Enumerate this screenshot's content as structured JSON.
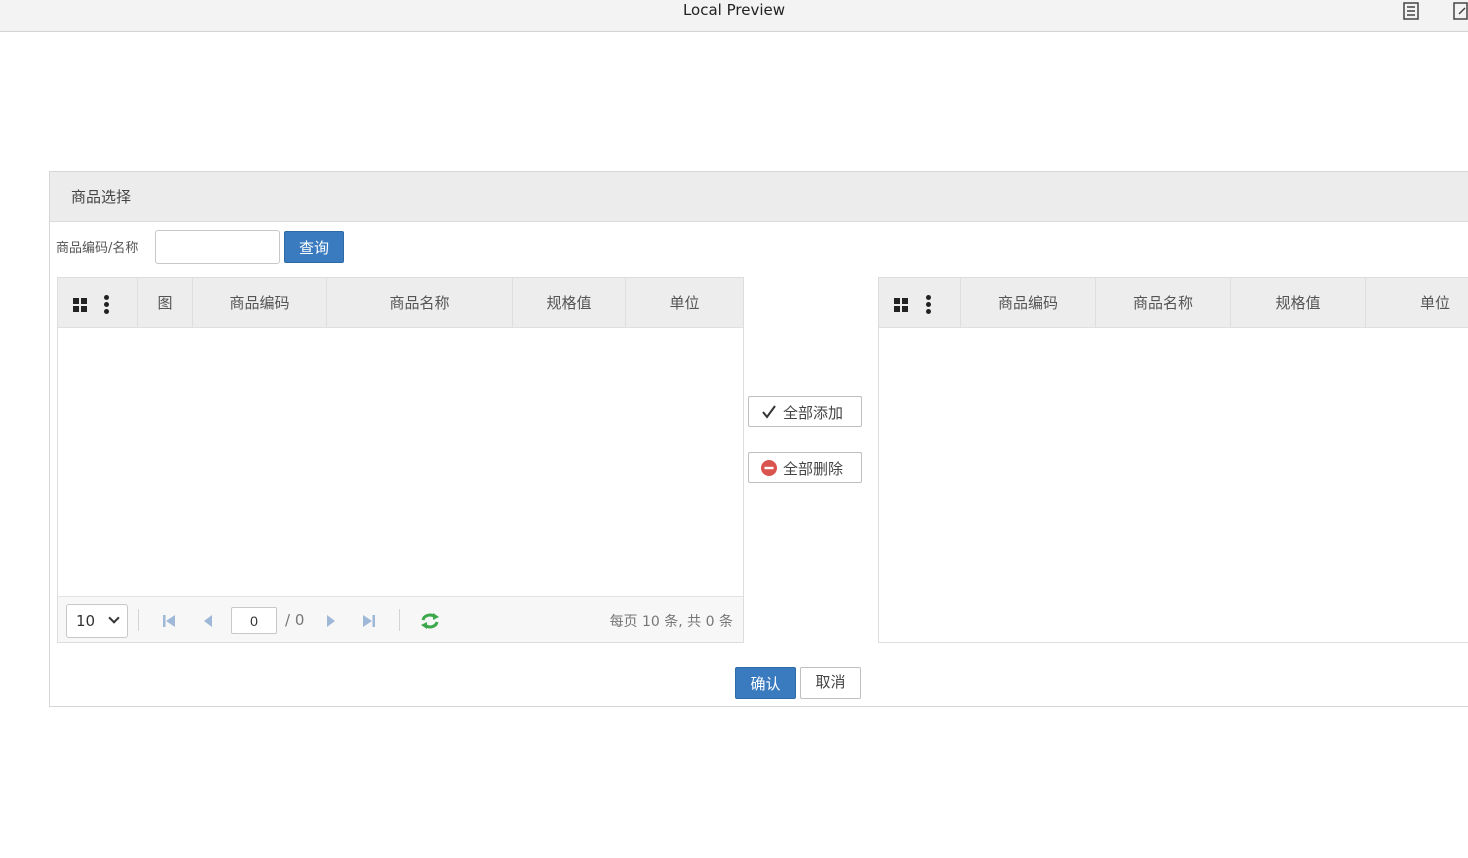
{
  "window": {
    "title": "Local Preview"
  },
  "dialog": {
    "title": "商品选择",
    "search": {
      "label": "商品编码/名称",
      "value": "",
      "query_label": "查询"
    },
    "left_grid": {
      "columns": [
        "图",
        "商品编码",
        "商品名称",
        "规格值",
        "单位"
      ],
      "rows": [],
      "pager": {
        "page_size": "10",
        "current_page": "0",
        "total_pages": "/ 0",
        "info": "每页 10 条, 共 0 条"
      }
    },
    "middle": {
      "add_all_label": "全部添加",
      "remove_all_label": "全部删除"
    },
    "right_grid": {
      "columns": [
        "商品编码",
        "商品名称",
        "规格值",
        "单位"
      ],
      "rows": []
    },
    "footer": {
      "confirm_label": "确认",
      "cancel_label": "取消"
    }
  },
  "colors": {
    "primary": "#3a7bbf",
    "header_bg": "#ececec",
    "refresh_green": "#3aa84b",
    "remove_red": "#d9534f",
    "pager_icon": "#9fb8d8"
  }
}
